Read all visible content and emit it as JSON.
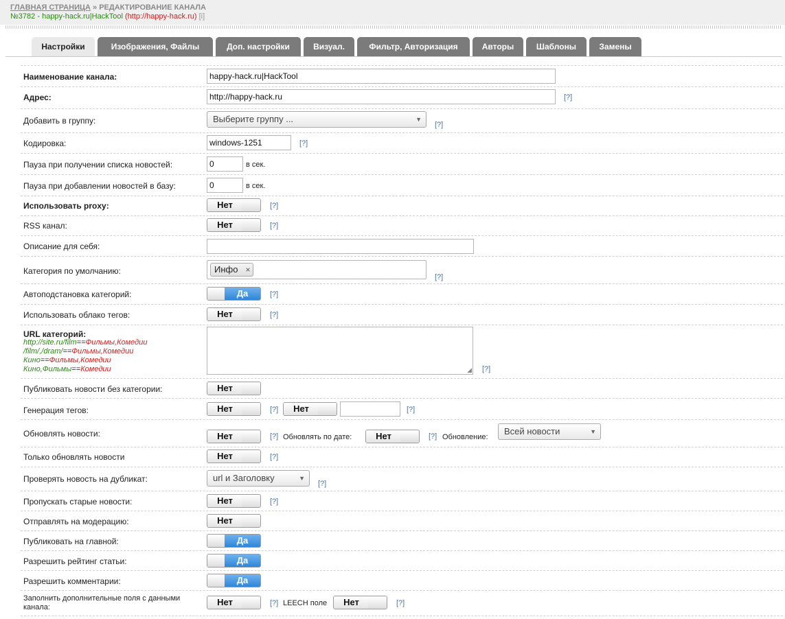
{
  "header": {
    "breadcrumb_home": "ГЛАВНАЯ СТРАНИЦА",
    "breadcrumb_sep": "»",
    "breadcrumb_current": "РЕДАКТИРОВАНИЕ КАНАЛА",
    "channel_id": "№3782",
    "channel_sep": "-",
    "channel_name": "happy-hack.ru|HackTool",
    "channel_url_open": "(",
    "channel_url": "http://happy-hack.ru",
    "channel_url_close": ")",
    "info_marker": "[i]"
  },
  "tabs": [
    {
      "label": "Настройки",
      "active": true
    },
    {
      "label": "Изображения, Файлы"
    },
    {
      "label": "Доп. настройки"
    },
    {
      "label": "Визуал."
    },
    {
      "label": "Фильтр, Авторизация"
    },
    {
      "label": "Авторы"
    },
    {
      "label": "Шаблоны"
    },
    {
      "label": "Замены"
    }
  ],
  "help_marker": "[?]",
  "fields": {
    "channel_name": {
      "label": "Наименование канала:",
      "value": "happy-hack.ru|HackTool"
    },
    "address": {
      "label": "Адрес:",
      "value": "http://happy-hack.ru"
    },
    "group": {
      "label": "Добавить в группу:",
      "value": "Выберите группу ..."
    },
    "encoding": {
      "label": "Кодировка:",
      "value": "windows-1251"
    },
    "pause_list": {
      "label": "Пауза при получении списка новостей:",
      "value": "0",
      "unit": "в сек."
    },
    "pause_add": {
      "label": "Пауза при добавлении новостей в базу:",
      "value": "0",
      "unit": "в сек."
    },
    "use_proxy": {
      "label": "Использовать proxy:",
      "state": "Нет"
    },
    "rss": {
      "label": "RSS канал:",
      "state": "Нет"
    },
    "description": {
      "label": "Описание для себя:",
      "value": ""
    },
    "default_category": {
      "label": "Категория по умолчанию:",
      "chip": "Инфо",
      "chip_remove": "×"
    },
    "auto_category": {
      "label": "Автоподстановка категорий:",
      "state": "Да"
    },
    "tag_cloud": {
      "label": "Использовать облако тегов:",
      "state": "Нет"
    },
    "url_categories": {
      "label": "URL категорий:",
      "examples": [
        {
          "left": "http://site.ru/film",
          "sep": "==",
          "right": "Фильмы,Комедии"
        },
        {
          "left": "/film/,/dram/",
          "sep": "==",
          "right": "Фильмы,Комедии"
        },
        {
          "left": "Кино",
          "sep": "==",
          "right": "Фильмы,Комедии"
        },
        {
          "left": "Кино,Фильмы",
          "sep": "==",
          "right": "Комедии"
        }
      ]
    },
    "publish_no_category": {
      "label": "Публиковать новости без категории:",
      "state": "Нет"
    },
    "tag_generation": {
      "label": "Генерация тегов:",
      "state": "Нет",
      "state2": "Нет",
      "value": ""
    },
    "update_news": {
      "label": "Обновлять новости:",
      "state": "Нет",
      "by_date_label": "Обновлять по дате:",
      "by_date_state": "Нет",
      "update_label": "Обновление:",
      "update_value": "Всей новости"
    },
    "only_update": {
      "label": "Только обновлять новости",
      "state": "Нет"
    },
    "duplicate_check": {
      "label": "Проверять новость на дубликат:",
      "value": "url и Заголовку"
    },
    "skip_old": {
      "label": "Пропускать старые новости:",
      "state": "Нет"
    },
    "moderation": {
      "label": "Отправлять на модерацию:",
      "state": "Нет"
    },
    "publish_main": {
      "label": "Публиковать на главной:",
      "state": "Да"
    },
    "rating": {
      "label": "Разрешить рейтинг статьи:",
      "state": "Да"
    },
    "comments": {
      "label": "Разрешить комментарии:",
      "state": "Да"
    },
    "extra_fields": {
      "label": "Заполнить дополнительные поля с данными канала:",
      "state": "Нет",
      "leech_label": "LEECH поле",
      "leech_state": "Нет"
    }
  }
}
